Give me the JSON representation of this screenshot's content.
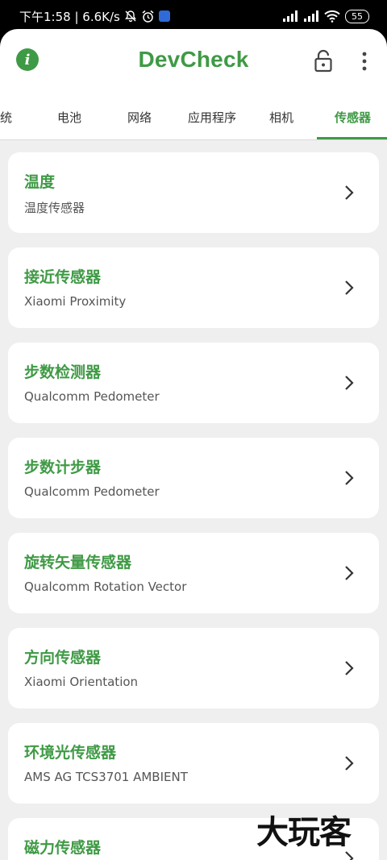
{
  "status_bar": {
    "time_speed": "下午1:58 | 6.6K/s",
    "battery": "55"
  },
  "toolbar": {
    "title": "DevCheck"
  },
  "tabs": [
    {
      "label": "统",
      "active": false
    },
    {
      "label": "电池",
      "active": false
    },
    {
      "label": "网络",
      "active": false
    },
    {
      "label": "应用程序",
      "active": false
    },
    {
      "label": "相机",
      "active": false
    },
    {
      "label": "传感器",
      "active": true
    }
  ],
  "sensors": [
    {
      "title": "温度",
      "subtitle": "温度传感器"
    },
    {
      "title": "接近传感器",
      "subtitle": "Xiaomi Proximity"
    },
    {
      "title": "步数检测器",
      "subtitle": "Qualcomm Pedometer"
    },
    {
      "title": "步数计步器",
      "subtitle": "Qualcomm Pedometer"
    },
    {
      "title": "旋转矢量传感器",
      "subtitle": "Qualcomm Rotation Vector"
    },
    {
      "title": "方向传感器",
      "subtitle": "Xiaomi Orientation"
    },
    {
      "title": "环境光传感器",
      "subtitle": "AMS AG TCS3701 AMBIENT"
    },
    {
      "title": "磁力传感器",
      "subtitle": ""
    }
  ],
  "watermark": "大玩客",
  "colors": {
    "accent": "#3f9a45",
    "list_bg": "#efefef"
  }
}
